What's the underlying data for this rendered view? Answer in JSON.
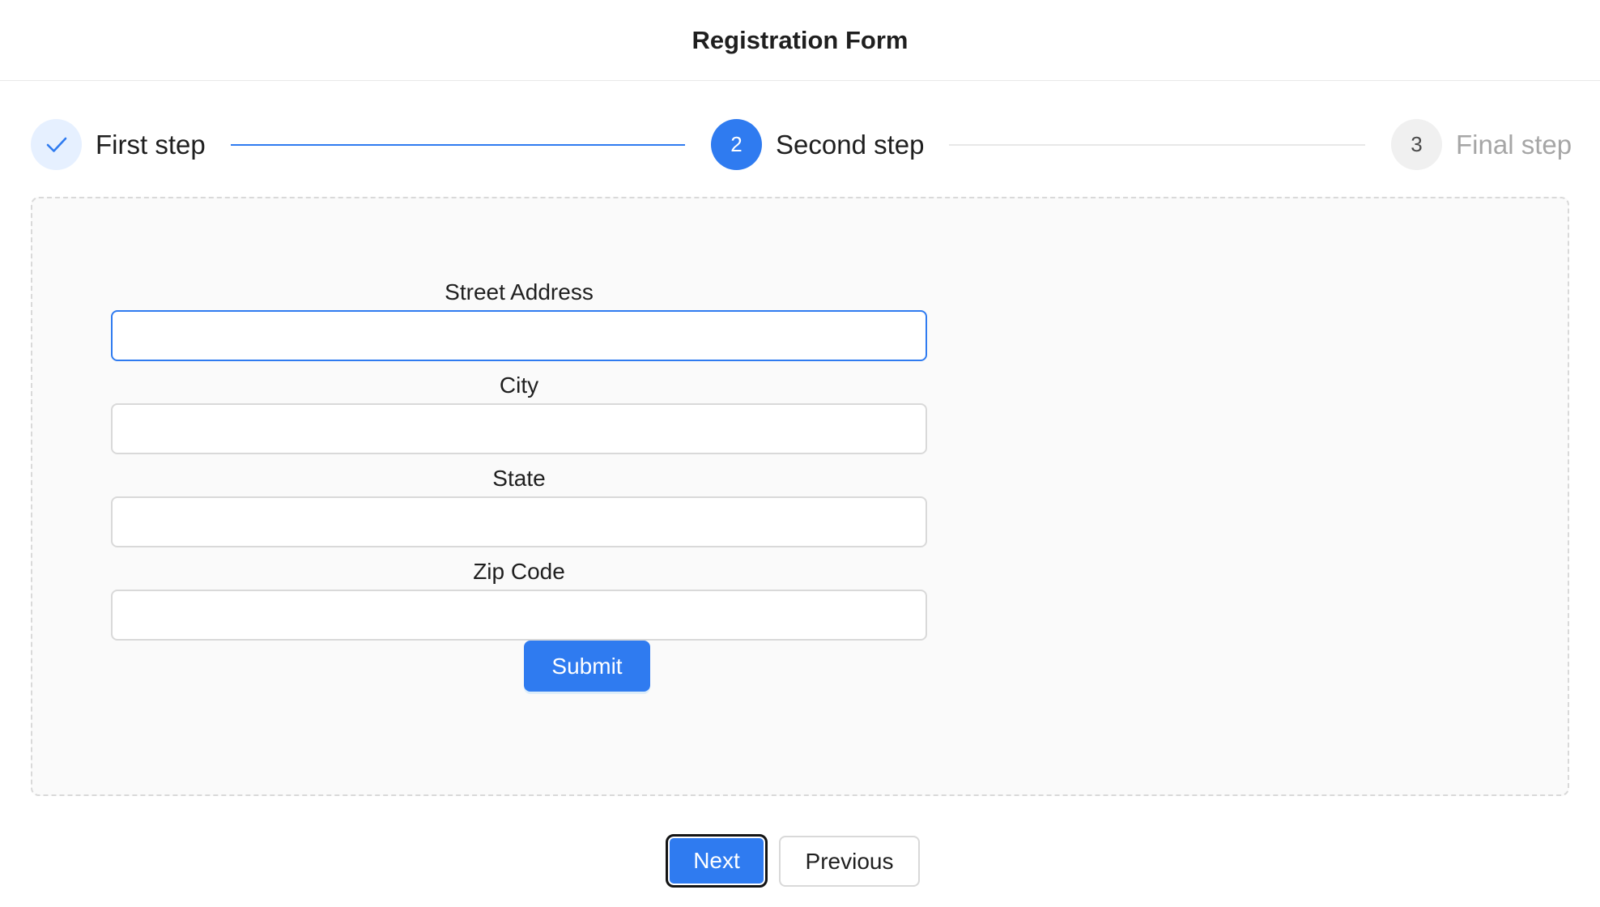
{
  "header": {
    "title": "Registration Form"
  },
  "steps": [
    {
      "title": "First step",
      "status": "finished",
      "icon": "check-icon"
    },
    {
      "title": "Second step",
      "status": "process",
      "number": "2"
    },
    {
      "title": "Final step",
      "status": "wait",
      "number": "3"
    }
  ],
  "form": {
    "fields": [
      {
        "label": "Street Address",
        "value": "",
        "placeholder": ""
      },
      {
        "label": "City",
        "value": "",
        "placeholder": ""
      },
      {
        "label": "State",
        "value": "",
        "placeholder": ""
      },
      {
        "label": "Zip Code",
        "value": "",
        "placeholder": ""
      }
    ],
    "submit_label": "Submit"
  },
  "nav": {
    "next_label": "Next",
    "previous_label": "Previous"
  },
  "colors": {
    "primary": "#2f7bf0",
    "finished_icon_bg": "#e6f0ff",
    "waiting_icon_bg": "#f0f0f0",
    "waiting_text": "#a6a6a6",
    "border": "#d9d9d9",
    "panel_bg": "#fafafa"
  }
}
